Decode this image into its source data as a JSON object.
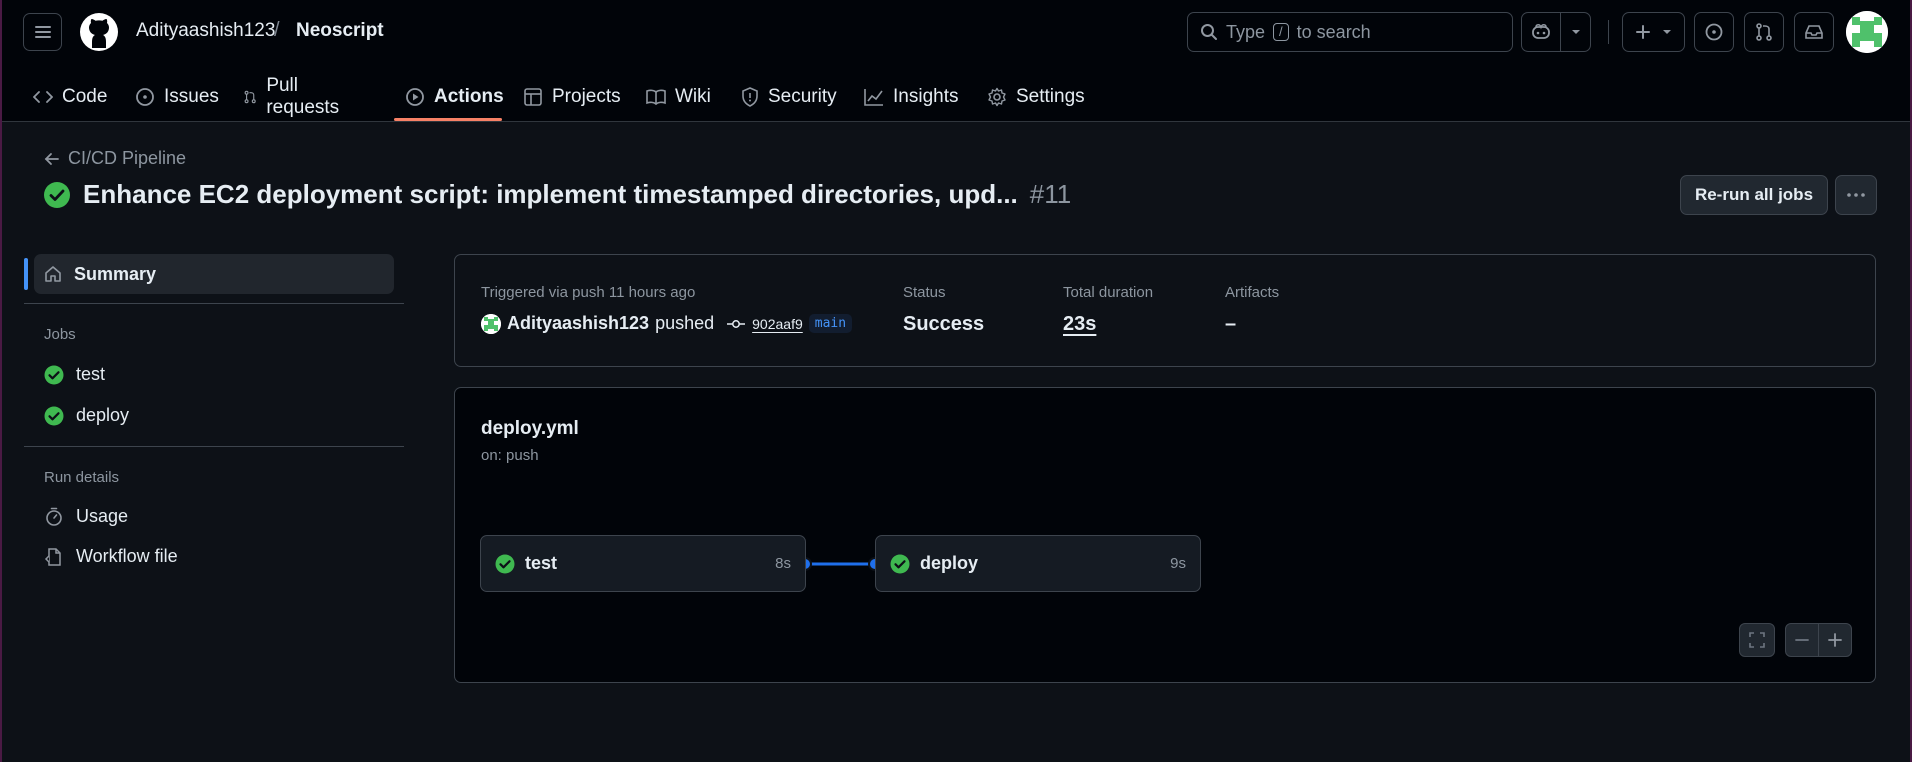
{
  "header": {
    "owner": "Adityaashish123",
    "separator": "/",
    "repo": "Neoscript",
    "search": {
      "prefix": "Type",
      "key": "/",
      "suffix": "to search"
    }
  },
  "tabs": [
    {
      "label": "Code",
      "icon": "code-icon"
    },
    {
      "label": "Issues",
      "icon": "issue-icon"
    },
    {
      "label": "Pull requests",
      "icon": "pull-request-icon"
    },
    {
      "label": "Actions",
      "icon": "play-icon",
      "active": true
    },
    {
      "label": "Projects",
      "icon": "table-icon"
    },
    {
      "label": "Wiki",
      "icon": "book-icon"
    },
    {
      "label": "Security",
      "icon": "shield-icon"
    },
    {
      "label": "Insights",
      "icon": "graph-icon"
    },
    {
      "label": "Settings",
      "icon": "gear-icon"
    }
  ],
  "run": {
    "back_label": "CI/CD Pipeline",
    "title": "Enhance EC2 deployment script: implement timestamped directories, upd...",
    "number": "#11",
    "rerun_label": "Re-run all jobs"
  },
  "sidebar": {
    "summary_label": "Summary",
    "jobs_heading": "Jobs",
    "jobs": [
      "test",
      "deploy"
    ],
    "run_details_heading": "Run details",
    "usage_label": "Usage",
    "workflow_file_label": "Workflow file"
  },
  "summary": {
    "triggered_label": "Triggered via push 11 hours ago",
    "actor": "Adityaashish123",
    "action": "pushed",
    "commit": "902aaf9",
    "branch": "main",
    "status_label": "Status",
    "status_value": "Success",
    "duration_label": "Total duration",
    "duration_value": "23s",
    "artifacts_label": "Artifacts",
    "artifacts_value": "–"
  },
  "workflow": {
    "file": "deploy.yml",
    "trigger": "on: push",
    "jobs": [
      {
        "name": "test",
        "duration": "8s"
      },
      {
        "name": "deploy",
        "duration": "9s"
      }
    ]
  },
  "colors": {
    "success": "#3fb950",
    "accent": "#4493f8",
    "active_tab_underline": "#f78166"
  }
}
